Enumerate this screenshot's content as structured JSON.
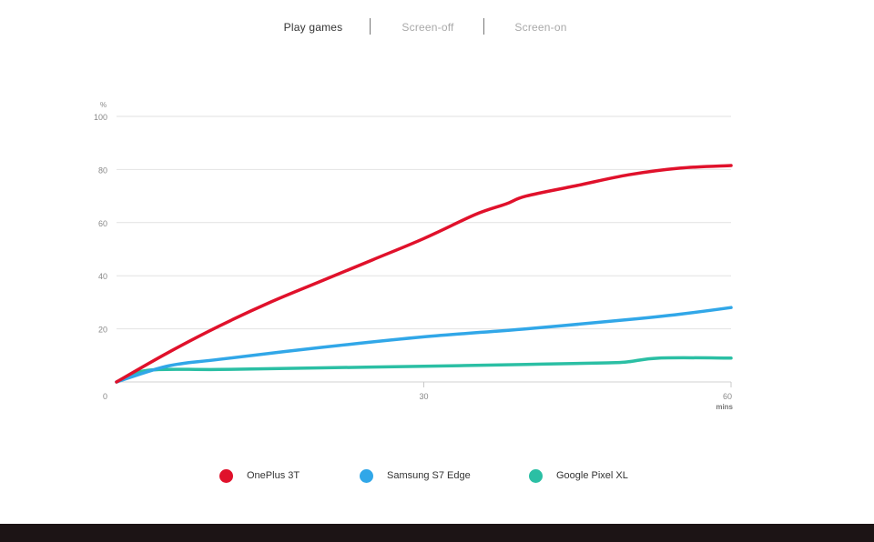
{
  "tabs": [
    {
      "label": "Play games",
      "active": true
    },
    {
      "label": "Screen-off",
      "active": false
    },
    {
      "label": "Screen-on",
      "active": false
    }
  ],
  "colors": {
    "grid": "#e2e2e2",
    "axis_text": "#888888",
    "footer": "#1c1415"
  },
  "chart_data": {
    "type": "line",
    "title": "",
    "ylabel": "%",
    "xlabel": "mins",
    "xlim": [
      0,
      60
    ],
    "ylim": [
      0,
      100
    ],
    "yticks": [
      0,
      20,
      40,
      60,
      80,
      100
    ],
    "xticks": [
      30,
      60
    ],
    "grid": true,
    "legend_position": "bottom",
    "series": [
      {
        "name": "OnePlus 3T",
        "color": "#e0112b",
        "x": [
          0,
          5,
          10,
          15,
          20,
          25,
          30,
          35,
          38,
          40,
          45,
          50,
          55,
          60
        ],
        "y": [
          0,
          11,
          21,
          30,
          38,
          46,
          54,
          63,
          67,
          70,
          74,
          78,
          80.5,
          81.5
        ]
      },
      {
        "name": "Samsung S7 Edge",
        "color": "#31a7e8",
        "x": [
          0,
          5,
          10,
          20,
          30,
          40,
          50,
          55,
          60
        ],
        "y": [
          0,
          6,
          8.5,
          13,
          17,
          20,
          23.5,
          25.5,
          28
        ]
      },
      {
        "name": "Google Pixel XL",
        "color": "#2bbfa4",
        "x": [
          0,
          3,
          10,
          20,
          30,
          40,
          48,
          50,
          53,
          60
        ],
        "y": [
          0,
          4.4,
          4.7,
          5.3,
          5.9,
          6.6,
          7.2,
          7.6,
          9,
          9
        ]
      }
    ]
  }
}
